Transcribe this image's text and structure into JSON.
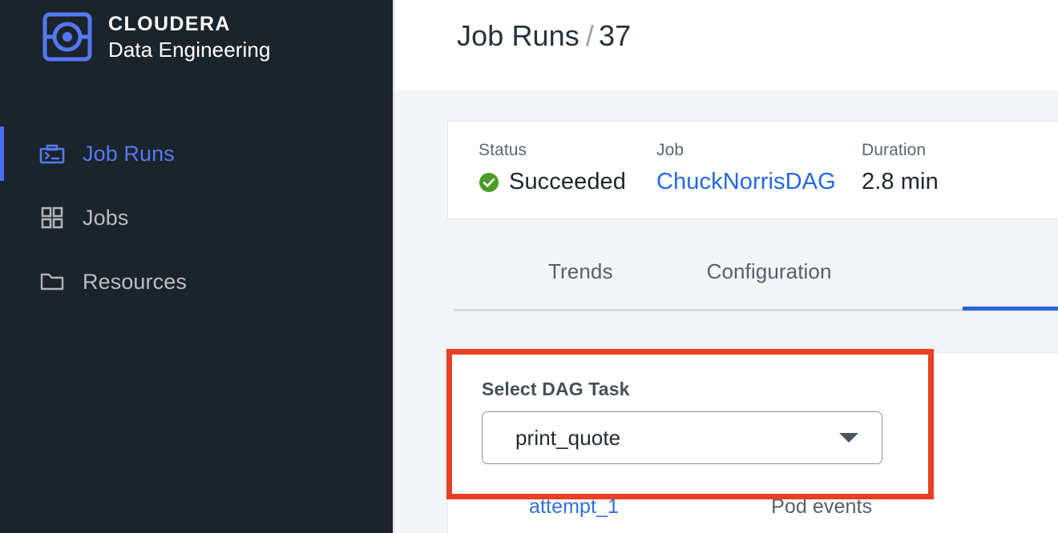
{
  "sidebar": {
    "brand": {
      "logo_icon": "cloudera-logo-icon",
      "line1": "CLOUDERA",
      "line2": "Data Engineering",
      "accent_color": "#5479f7"
    },
    "items": [
      {
        "label": "Job Runs",
        "icon": "job-runs-terminal-icon",
        "active": true
      },
      {
        "label": "Jobs",
        "icon": "jobs-grid-icon",
        "active": false
      },
      {
        "label": "Resources",
        "icon": "resources-folder-icon",
        "active": false
      }
    ],
    "background_color": "#1b242b"
  },
  "header": {
    "breadcrumb_root": "Job Runs",
    "breadcrumb_separator": "/",
    "breadcrumb_current": "37"
  },
  "summary": {
    "status": {
      "label": "Status",
      "value": "Succeeded",
      "icon": "success-check-icon",
      "color": "#4a9b28"
    },
    "job": {
      "label": "Job",
      "value": "ChuckNorrisDAG",
      "link_color": "#2667e8"
    },
    "duration": {
      "label": "Duration",
      "value": "2.8 min"
    }
  },
  "tabs": {
    "items": [
      {
        "label": "Trends",
        "active": false
      },
      {
        "label": "Configuration",
        "active": false
      }
    ],
    "active_indicator_color": "#2667d8"
  },
  "dag_panel": {
    "field_label": "Select DAG Task",
    "select": {
      "value": "print_quote",
      "caret_icon": "chevron-down-icon"
    },
    "attempt_link": "attempt_1",
    "pod_events_label": "Pod events"
  },
  "annotation": {
    "highlight_color": "#ea3f22"
  }
}
